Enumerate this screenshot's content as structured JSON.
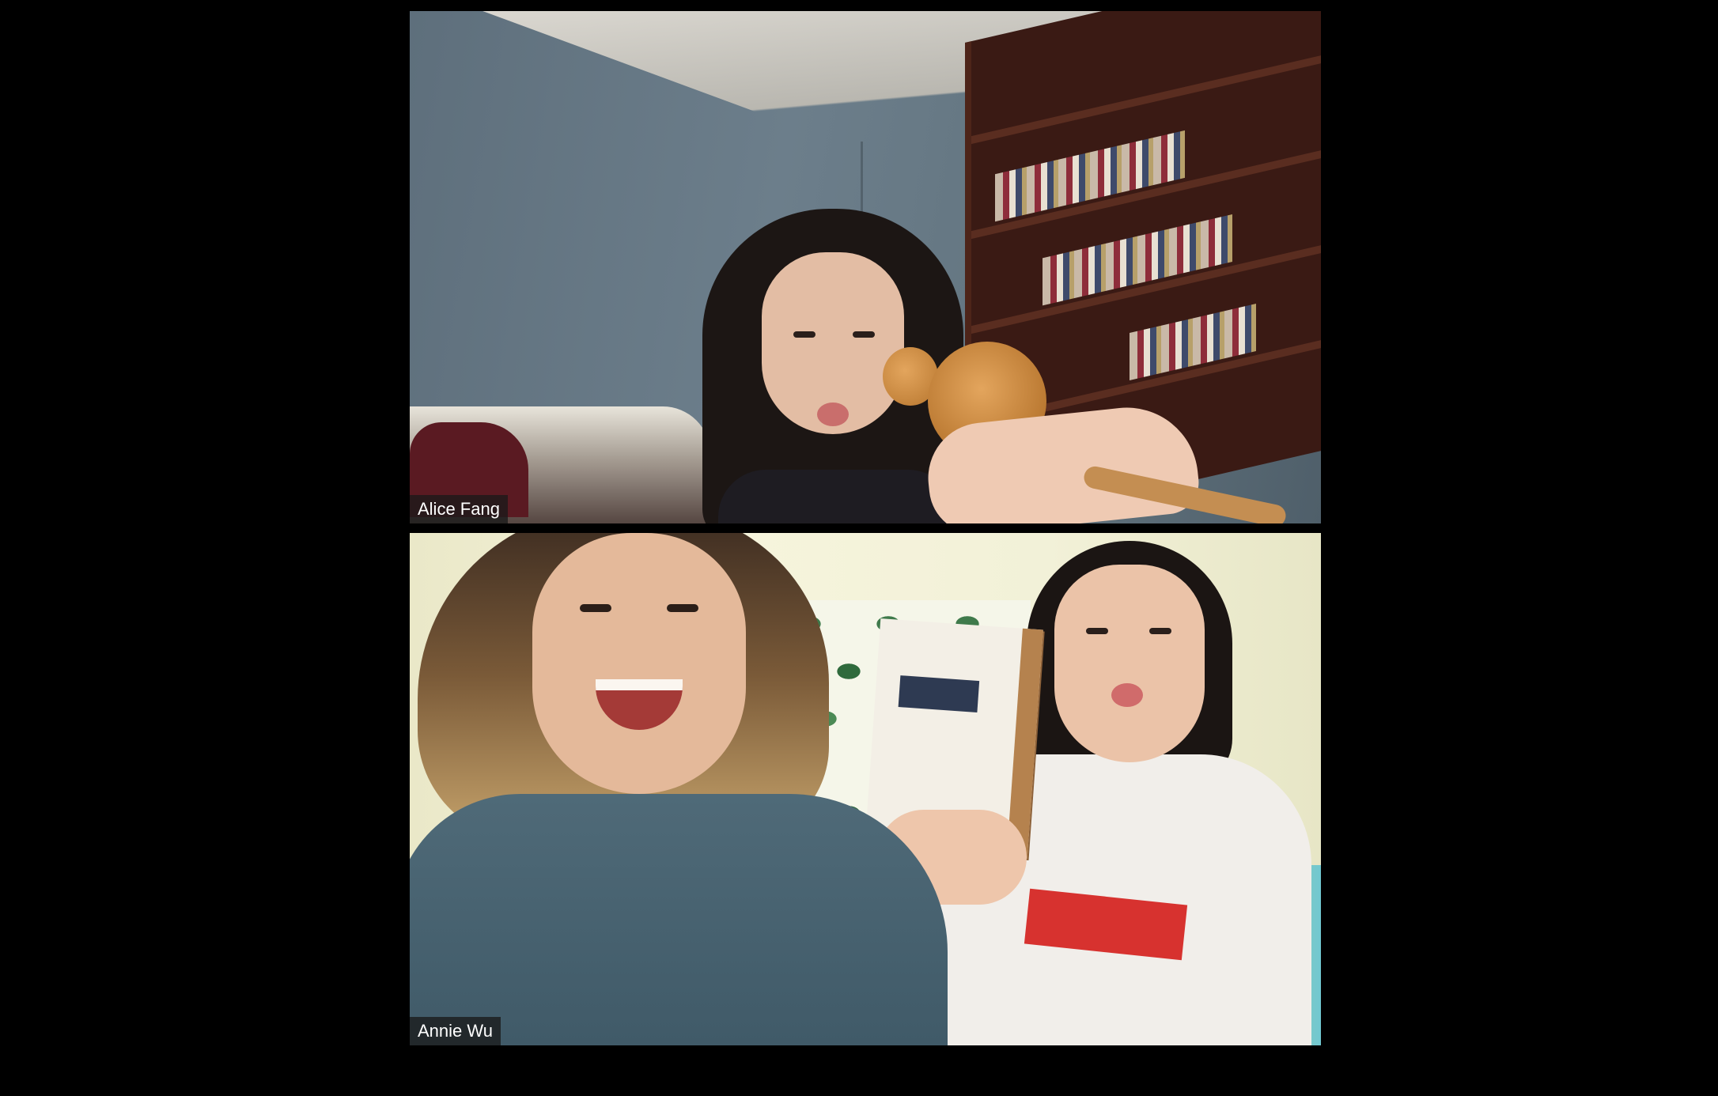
{
  "meeting": {
    "background_color": "#000000",
    "participants": [
      {
        "name": "Alice Fang"
      },
      {
        "name": "Annie Wu"
      }
    ]
  }
}
